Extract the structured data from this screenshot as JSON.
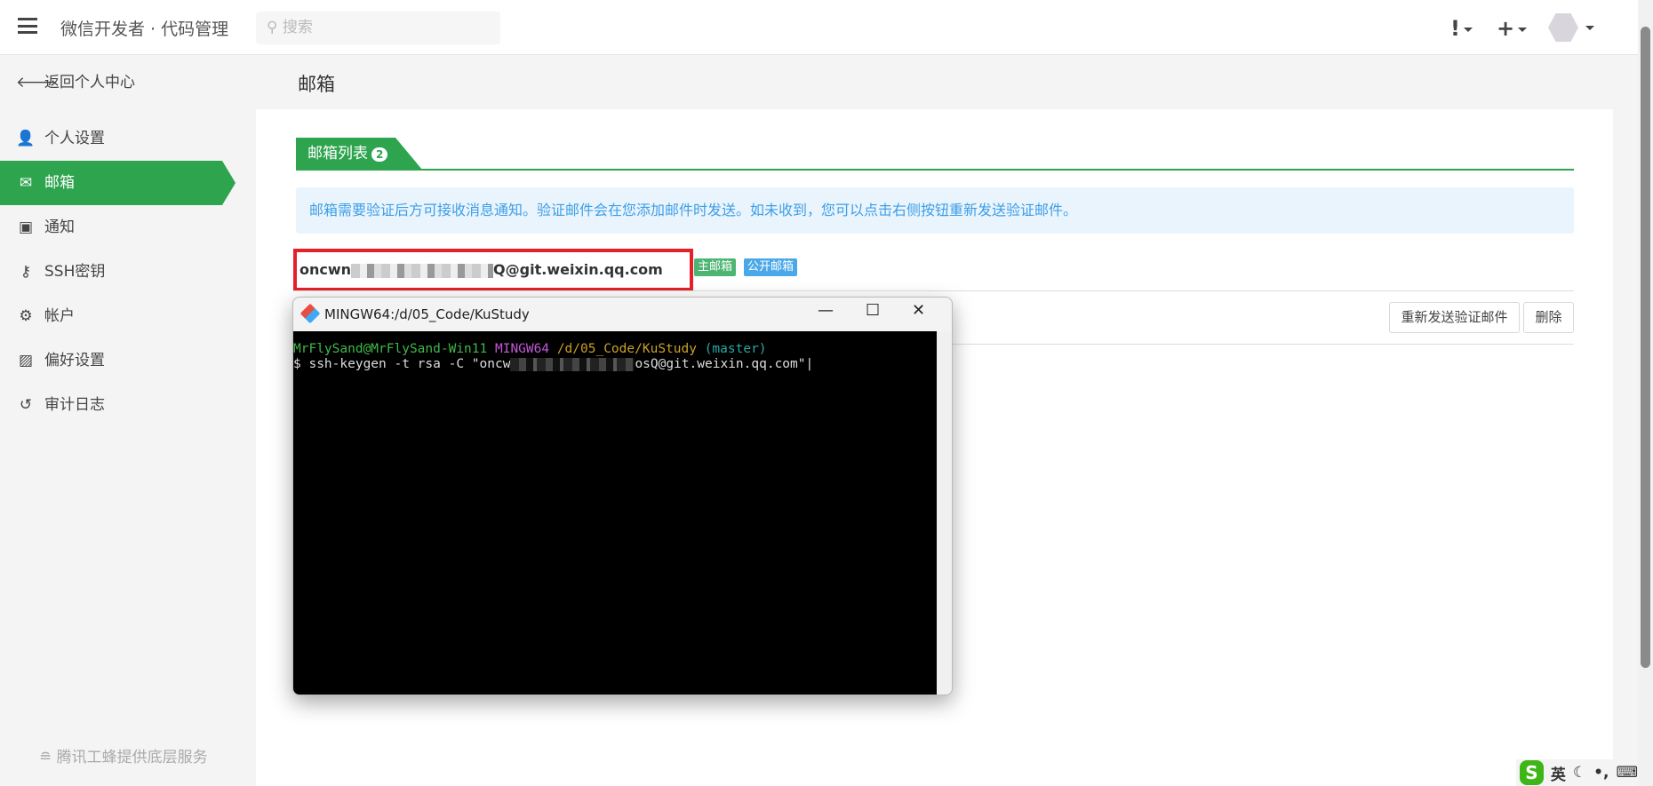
{
  "header": {
    "app_title": "微信开发者 · 代码管理",
    "search_placeholder": "搜索",
    "alert_glyph": "!",
    "plus_glyph": "+"
  },
  "sidebar": {
    "back": "返回个人中心",
    "items": [
      {
        "label": "个人设置",
        "icon": "user-icon"
      },
      {
        "label": "邮箱",
        "icon": "envelope-icon"
      },
      {
        "label": "通知",
        "icon": "inbox-icon"
      },
      {
        "label": "SSH密钥",
        "icon": "key-icon"
      },
      {
        "label": "帐户",
        "icon": "gear-icon"
      },
      {
        "label": "偏好设置",
        "icon": "image-icon"
      },
      {
        "label": "审计日志",
        "icon": "history-icon"
      }
    ],
    "footer": "腾讯工蜂提供底层服务"
  },
  "main": {
    "title": "邮箱",
    "tab_label": "邮箱列表",
    "tab_count": "2",
    "info": "邮箱需要验证后方可接收消息通知。验证邮件会在您添加邮件时发送。如未收到，您可以点击右侧按钮重新发送验证邮件。",
    "email_prefix": "oncwn",
    "email_suffix": "Q@git.weixin.qq.com",
    "badge_primary": "主邮箱",
    "badge_public": "公开邮箱",
    "resend_button": "重新发送验证邮件",
    "delete_button": "删除"
  },
  "terminal": {
    "title": "MINGW64:/d/05_Code/KuStudy",
    "user_host": "MrFlySand@MrFlySand-Win11",
    "env": "MINGW64",
    "path": "/d/05_Code/KuStudy",
    "branch": "(master)",
    "cmd_prefix": "$ ssh-keygen -t rsa -C \"oncw",
    "cmd_suffix": "osQ@git.weixin.qq.com\""
  },
  "ime": {
    "lang": "英"
  },
  "colors": {
    "green": "#2ea44f",
    "info": "#3d9ee6",
    "red": "#e5202a"
  }
}
